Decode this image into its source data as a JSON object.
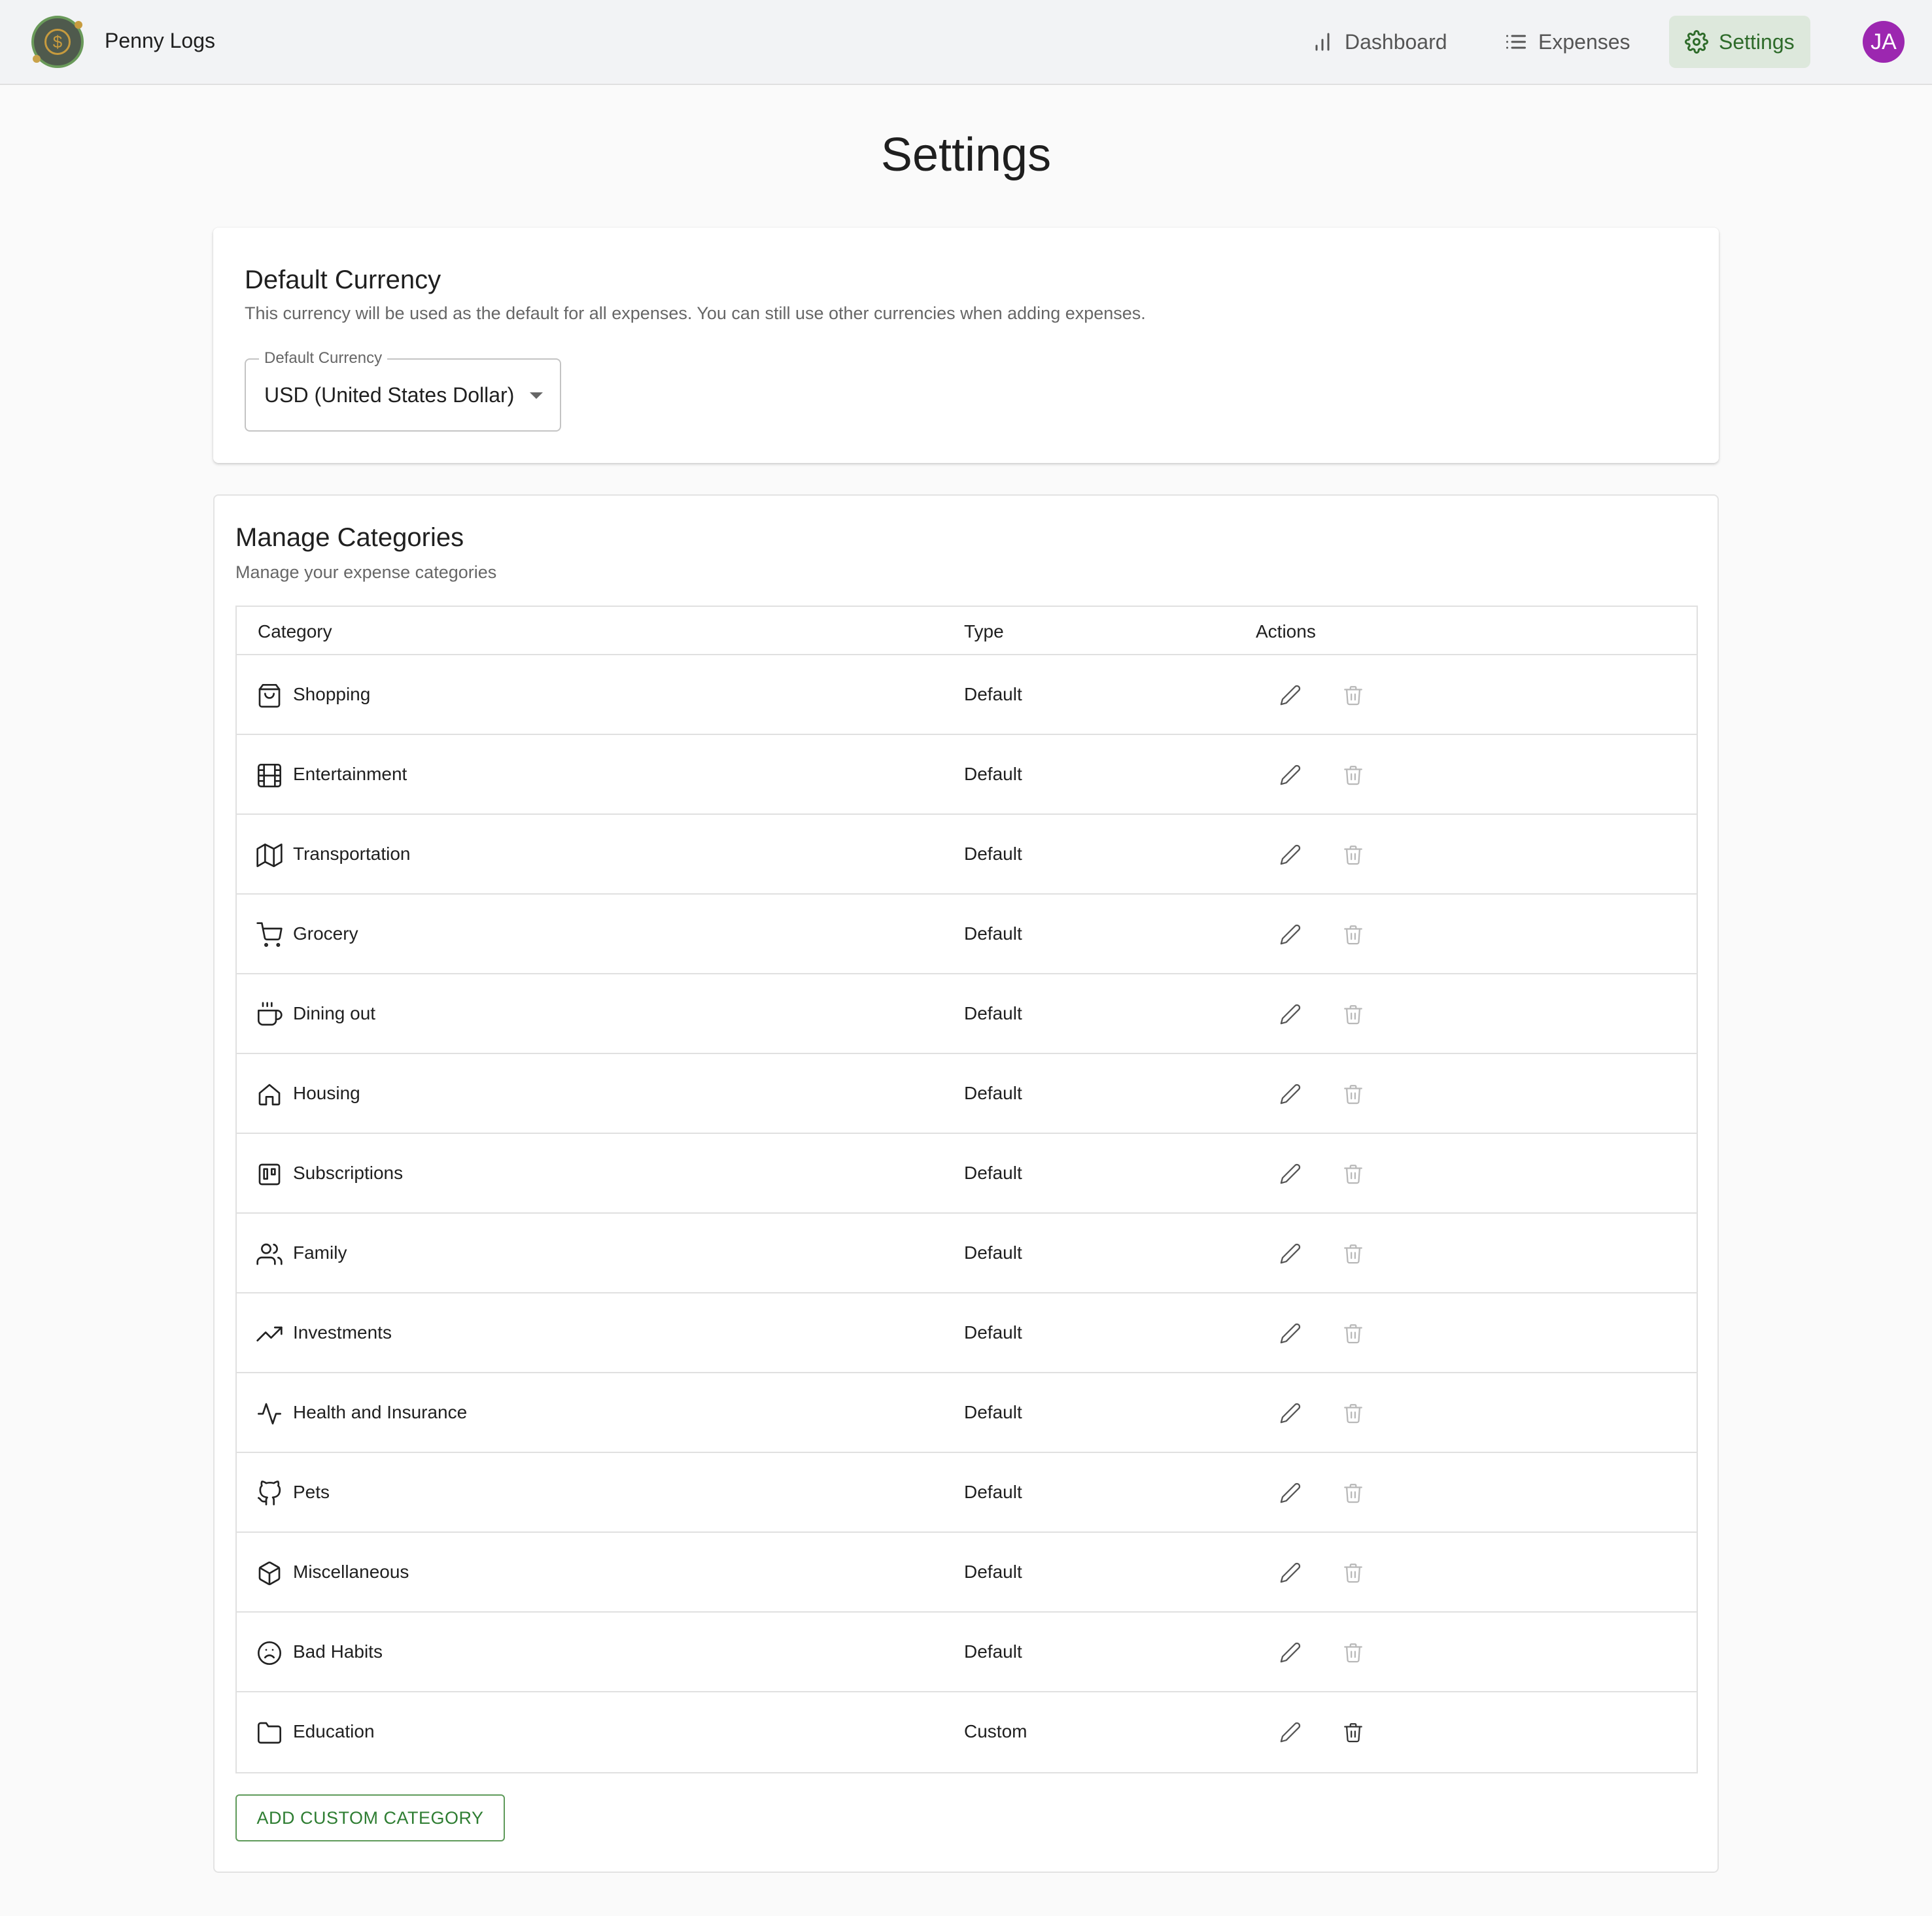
{
  "app": {
    "title": "Penny Logs",
    "logo_symbol": "$",
    "avatar_initials": "JA"
  },
  "nav": {
    "dashboard": "Dashboard",
    "expenses": "Expenses",
    "settings": "Settings"
  },
  "page": {
    "title": "Settings"
  },
  "currency": {
    "title": "Default Currency",
    "description": "This currency will be used as the default for all expenses. You can still use other currencies when adding expenses.",
    "field_label": "Default Currency",
    "value": "USD (United States Dollar)"
  },
  "categories": {
    "title": "Manage Categories",
    "description": "Manage your expense categories",
    "headers": {
      "category": "Category",
      "type": "Type",
      "actions": "Actions"
    },
    "rows": [
      {
        "name": "Shopping",
        "type": "Default",
        "icon": "shopping-bag-icon"
      },
      {
        "name": "Entertainment",
        "type": "Default",
        "icon": "film-icon"
      },
      {
        "name": "Transportation",
        "type": "Default",
        "icon": "map-icon"
      },
      {
        "name": "Grocery",
        "type": "Default",
        "icon": "cart-icon"
      },
      {
        "name": "Dining out",
        "type": "Default",
        "icon": "coffee-icon"
      },
      {
        "name": "Housing",
        "type": "Default",
        "icon": "home-icon"
      },
      {
        "name": "Subscriptions",
        "type": "Default",
        "icon": "trello-icon"
      },
      {
        "name": "Family",
        "type": "Default",
        "icon": "users-icon"
      },
      {
        "name": "Investments",
        "type": "Default",
        "icon": "trending-up-icon"
      },
      {
        "name": "Health and Insurance",
        "type": "Default",
        "icon": "activity-icon"
      },
      {
        "name": "Pets",
        "type": "Default",
        "icon": "github-icon"
      },
      {
        "name": "Miscellaneous",
        "type": "Default",
        "icon": "box-icon"
      },
      {
        "name": "Bad Habits",
        "type": "Default",
        "icon": "frown-icon"
      },
      {
        "name": "Education",
        "type": "Custom",
        "icon": "folder-icon"
      }
    ],
    "add_button": "ADD CUSTOM CATEGORY"
  },
  "colors": {
    "accent": "#2e7d32",
    "nav_active_bg": "#dde8dc",
    "avatar": "#9c27b0"
  }
}
